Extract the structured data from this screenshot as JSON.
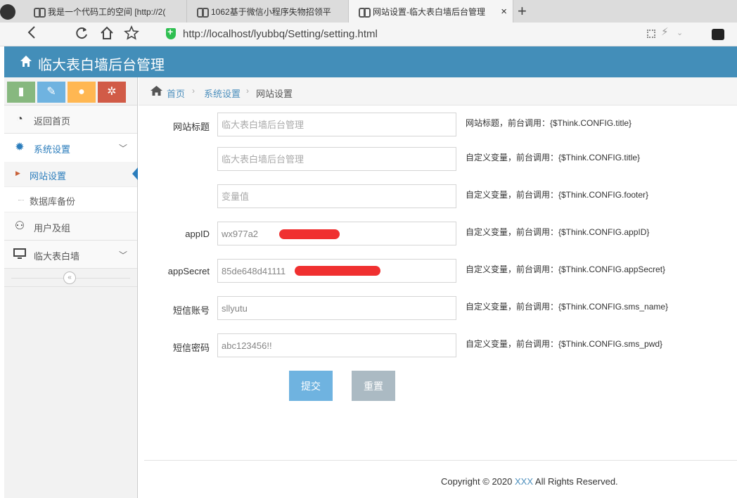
{
  "browser": {
    "tabs": [
      {
        "title": "我是一个代码工的空间 [http://2("
      },
      {
        "title": "1062基于微信小程序失物招领平"
      },
      {
        "title": "网站设置-临大表白墙后台管理",
        "active": true
      }
    ],
    "new_tab": "+",
    "close": "×",
    "url": "http://localhost/lyubbq/Setting/setting.html"
  },
  "app": {
    "title": "临大表白墙后台管理",
    "colors": {
      "header": "#438eb9",
      "link": "#4c8fbd",
      "submit": "#6fb3e0",
      "reset": "#abbac3"
    }
  },
  "sidebar": {
    "shortcuts": [
      {
        "icon": "signal-icon",
        "color": "#87b87f"
      },
      {
        "icon": "pencil-icon",
        "color": "#6fb3e0"
      },
      {
        "icon": "users-icon",
        "color": "#ffb752"
      },
      {
        "icon": "cogs-icon",
        "color": "#d15b47"
      }
    ],
    "items": [
      {
        "label": "返回首页",
        "icon": "dashboard-icon"
      },
      {
        "label": "系统设置",
        "icon": "gear-icon",
        "open": true,
        "children": [
          {
            "label": "网站设置",
            "active": true
          },
          {
            "label": "数据库备份"
          }
        ]
      },
      {
        "label": "用户及组",
        "icon": "users-icon"
      },
      {
        "label": "临大表白墙",
        "icon": "monitor-icon"
      }
    ]
  },
  "breadcrumb": {
    "home": "首页",
    "section": "系统设置",
    "current": "网站设置"
  },
  "form": {
    "fields": [
      {
        "label": "网站标题",
        "value": "",
        "placeholder": "临大表白墙后台管理",
        "help": "网站标题，前台调用：{$Think.CONFIG.title}"
      },
      {
        "label": "",
        "value": "",
        "placeholder": "临大表白墙后台管理",
        "help": "自定义变量，前台调用：{$Think.CONFIG.title}"
      },
      {
        "label": "",
        "value": "",
        "placeholder": "变量值",
        "help": "自定义变量，前台调用：{$Think.CONFIG.footer}"
      },
      {
        "label": "appID",
        "value": "wx977a2                    b",
        "placeholder": "",
        "help": "自定义变量，前台调用：{$Think.CONFIG.appID}"
      },
      {
        "label": "appSecret",
        "value": "85de648d41111                          8335",
        "placeholder": "",
        "help": "自定义变量，前台调用：{$Think.CONFIG.appSecret}"
      },
      {
        "label": "短信账号",
        "value": "sllyutu",
        "placeholder": "",
        "help": "自定义变量，前台调用：{$Think.CONFIG.sms_name}"
      },
      {
        "label": "短信密码",
        "value": "abc123456!!",
        "placeholder": "",
        "help": "自定义变量，前台调用：{$Think.CONFIG.sms_pwd}"
      }
    ],
    "submit_label": "提交",
    "reset_label": "重置"
  },
  "footer": {
    "prefix": "Copyright © 2020 ",
    "brand": "XXX",
    "suffix": " All Rights Reserved."
  }
}
